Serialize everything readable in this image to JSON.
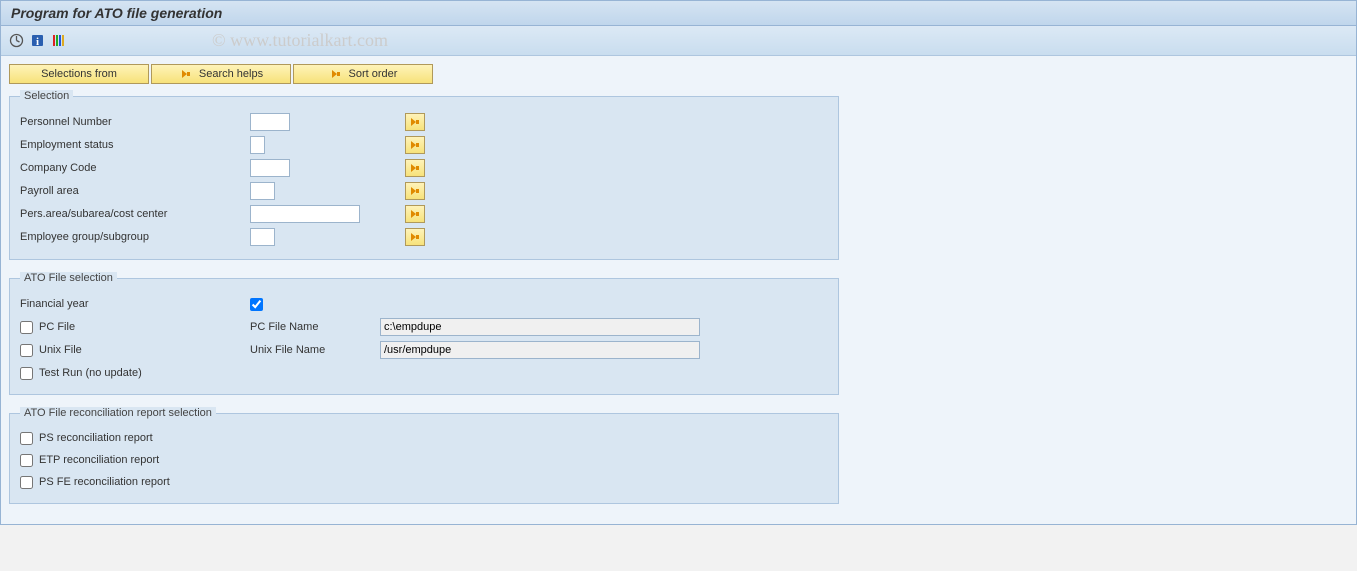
{
  "title": "Program for ATO file generation",
  "watermark": "© www.tutorialkart.com",
  "top_buttons": {
    "selections_from": "Selections from",
    "search_helps": "Search helps",
    "sort_order": "Sort order"
  },
  "selection": {
    "legend": "Selection",
    "fields": {
      "personnel_number": {
        "label": "Personnel Number",
        "value": ""
      },
      "employment_status": {
        "label": "Employment status",
        "value": ""
      },
      "company_code": {
        "label": "Company Code",
        "value": ""
      },
      "payroll_area": {
        "label": "Payroll area",
        "value": ""
      },
      "pers_area": {
        "label": "Pers.area/subarea/cost center",
        "value": ""
      },
      "employee_group": {
        "label": "Employee group/subgroup",
        "value": ""
      }
    }
  },
  "ato_file": {
    "legend": "ATO File selection",
    "financial_year_label": "Financial year",
    "financial_year_checked": true,
    "pc_file": {
      "checkbox_label": "PC File",
      "checked": false,
      "name_label": "PC File Name",
      "value": "c:\\empdupe"
    },
    "unix_file": {
      "checkbox_label": "Unix File",
      "checked": false,
      "name_label": "Unix File Name",
      "value": "/usr/empdupe"
    },
    "test_run": {
      "label": "Test Run (no update)",
      "checked": false
    }
  },
  "recon": {
    "legend": "ATO File reconciliation report selection",
    "items": {
      "ps": {
        "label": "PS reconciliation report",
        "checked": false
      },
      "etp": {
        "label": "ETP reconciliation report",
        "checked": false
      },
      "ps_fe": {
        "label": "PS FE reconciliation report",
        "checked": false
      }
    }
  }
}
